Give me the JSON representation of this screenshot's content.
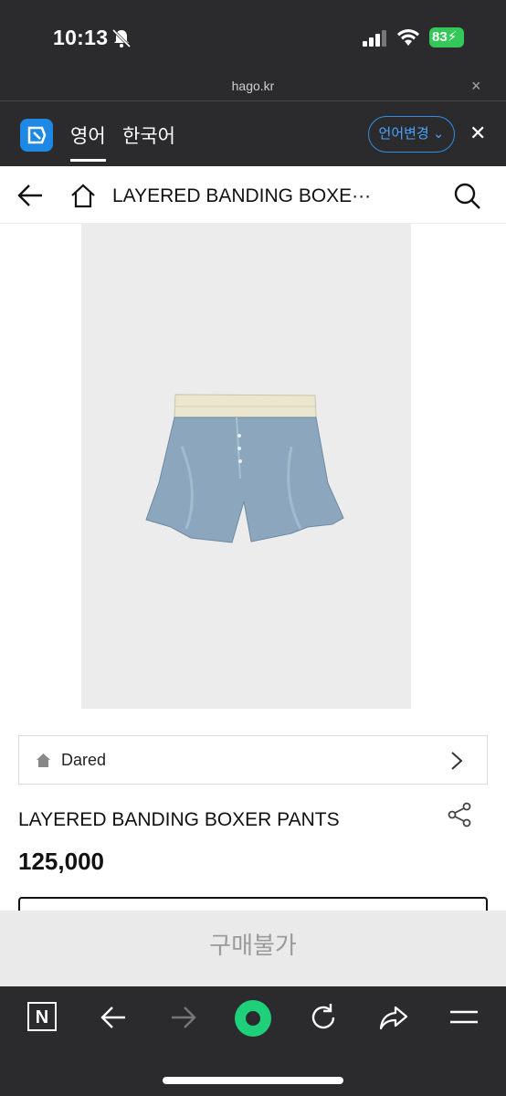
{
  "status": {
    "time": "10:13",
    "battery": "83"
  },
  "url_bar": {
    "domain": "hago.kr",
    "close": "×"
  },
  "translate": {
    "tab_active": "영어",
    "tab_other": "한국어",
    "change_label": "언어변경 ⌄",
    "close": "✕"
  },
  "header": {
    "title": "LAYERED BANDING BOXE···"
  },
  "brand": {
    "name": "Dared"
  },
  "product": {
    "title": "LAYERED BANDING BOXER PANTS",
    "price": "125,000"
  },
  "buy": {
    "label": "구매불가"
  },
  "toolbar": {
    "n_label": "N"
  },
  "colors": {
    "accent": "#2e8fe8",
    "battery": "#34c759",
    "center_button": "#1ed07a"
  }
}
